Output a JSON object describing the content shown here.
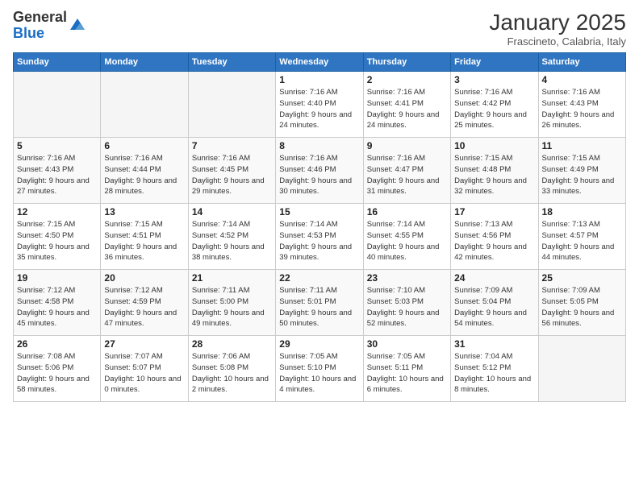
{
  "logo": {
    "general": "General",
    "blue": "Blue"
  },
  "header": {
    "month": "January 2025",
    "location": "Frascineto, Calabria, Italy"
  },
  "days_of_week": [
    "Sunday",
    "Monday",
    "Tuesday",
    "Wednesday",
    "Thursday",
    "Friday",
    "Saturday"
  ],
  "weeks": [
    [
      {
        "day": "",
        "empty": true
      },
      {
        "day": "",
        "empty": true
      },
      {
        "day": "",
        "empty": true
      },
      {
        "day": "1",
        "sunrise": "7:16 AM",
        "sunset": "4:40 PM",
        "daylight": "9 hours and 24 minutes."
      },
      {
        "day": "2",
        "sunrise": "7:16 AM",
        "sunset": "4:41 PM",
        "daylight": "9 hours and 24 minutes."
      },
      {
        "day": "3",
        "sunrise": "7:16 AM",
        "sunset": "4:42 PM",
        "daylight": "9 hours and 25 minutes."
      },
      {
        "day": "4",
        "sunrise": "7:16 AM",
        "sunset": "4:43 PM",
        "daylight": "9 hours and 26 minutes."
      }
    ],
    [
      {
        "day": "5",
        "sunrise": "7:16 AM",
        "sunset": "4:43 PM",
        "daylight": "9 hours and 27 minutes."
      },
      {
        "day": "6",
        "sunrise": "7:16 AM",
        "sunset": "4:44 PM",
        "daylight": "9 hours and 28 minutes."
      },
      {
        "day": "7",
        "sunrise": "7:16 AM",
        "sunset": "4:45 PM",
        "daylight": "9 hours and 29 minutes."
      },
      {
        "day": "8",
        "sunrise": "7:16 AM",
        "sunset": "4:46 PM",
        "daylight": "9 hours and 30 minutes."
      },
      {
        "day": "9",
        "sunrise": "7:16 AM",
        "sunset": "4:47 PM",
        "daylight": "9 hours and 31 minutes."
      },
      {
        "day": "10",
        "sunrise": "7:15 AM",
        "sunset": "4:48 PM",
        "daylight": "9 hours and 32 minutes."
      },
      {
        "day": "11",
        "sunrise": "7:15 AM",
        "sunset": "4:49 PM",
        "daylight": "9 hours and 33 minutes."
      }
    ],
    [
      {
        "day": "12",
        "sunrise": "7:15 AM",
        "sunset": "4:50 PM",
        "daylight": "9 hours and 35 minutes."
      },
      {
        "day": "13",
        "sunrise": "7:15 AM",
        "sunset": "4:51 PM",
        "daylight": "9 hours and 36 minutes."
      },
      {
        "day": "14",
        "sunrise": "7:14 AM",
        "sunset": "4:52 PM",
        "daylight": "9 hours and 38 minutes."
      },
      {
        "day": "15",
        "sunrise": "7:14 AM",
        "sunset": "4:53 PM",
        "daylight": "9 hours and 39 minutes."
      },
      {
        "day": "16",
        "sunrise": "7:14 AM",
        "sunset": "4:55 PM",
        "daylight": "9 hours and 40 minutes."
      },
      {
        "day": "17",
        "sunrise": "7:13 AM",
        "sunset": "4:56 PM",
        "daylight": "9 hours and 42 minutes."
      },
      {
        "day": "18",
        "sunrise": "7:13 AM",
        "sunset": "4:57 PM",
        "daylight": "9 hours and 44 minutes."
      }
    ],
    [
      {
        "day": "19",
        "sunrise": "7:12 AM",
        "sunset": "4:58 PM",
        "daylight": "9 hours and 45 minutes."
      },
      {
        "day": "20",
        "sunrise": "7:12 AM",
        "sunset": "4:59 PM",
        "daylight": "9 hours and 47 minutes."
      },
      {
        "day": "21",
        "sunrise": "7:11 AM",
        "sunset": "5:00 PM",
        "daylight": "9 hours and 49 minutes."
      },
      {
        "day": "22",
        "sunrise": "7:11 AM",
        "sunset": "5:01 PM",
        "daylight": "9 hours and 50 minutes."
      },
      {
        "day": "23",
        "sunrise": "7:10 AM",
        "sunset": "5:03 PM",
        "daylight": "9 hours and 52 minutes."
      },
      {
        "day": "24",
        "sunrise": "7:09 AM",
        "sunset": "5:04 PM",
        "daylight": "9 hours and 54 minutes."
      },
      {
        "day": "25",
        "sunrise": "7:09 AM",
        "sunset": "5:05 PM",
        "daylight": "9 hours and 56 minutes."
      }
    ],
    [
      {
        "day": "26",
        "sunrise": "7:08 AM",
        "sunset": "5:06 PM",
        "daylight": "9 hours and 58 minutes."
      },
      {
        "day": "27",
        "sunrise": "7:07 AM",
        "sunset": "5:07 PM",
        "daylight": "10 hours and 0 minutes."
      },
      {
        "day": "28",
        "sunrise": "7:06 AM",
        "sunset": "5:08 PM",
        "daylight": "10 hours and 2 minutes."
      },
      {
        "day": "29",
        "sunrise": "7:05 AM",
        "sunset": "5:10 PM",
        "daylight": "10 hours and 4 minutes."
      },
      {
        "day": "30",
        "sunrise": "7:05 AM",
        "sunset": "5:11 PM",
        "daylight": "10 hours and 6 minutes."
      },
      {
        "day": "31",
        "sunrise": "7:04 AM",
        "sunset": "5:12 PM",
        "daylight": "10 hours and 8 minutes."
      },
      {
        "day": "",
        "empty": true
      }
    ]
  ]
}
